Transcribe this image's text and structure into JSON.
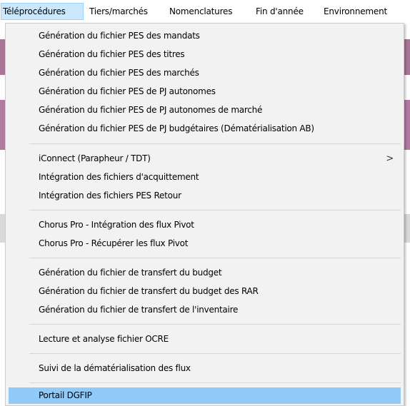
{
  "menubar": {
    "items": [
      {
        "label": "Téléprocédures"
      },
      {
        "label": "Tiers/marchés"
      },
      {
        "label": "Nomenclatures"
      },
      {
        "label": "Fin d'année"
      },
      {
        "label": "Environnement"
      }
    ]
  },
  "dropdown": {
    "groups": [
      {
        "items": [
          {
            "label": "Génération du fichier PES des mandats"
          },
          {
            "label": "Génération du fichier PES des titres"
          },
          {
            "label": "Génération du fichier PES des marchés"
          },
          {
            "label": "Génération du fichier PES de PJ autonomes"
          },
          {
            "label": "Génération du fichier PES de PJ autonomes de marché"
          },
          {
            "label": "Génération du fichier PES de PJ budgétaires (Dématérialisation AB)"
          }
        ]
      },
      {
        "items": [
          {
            "label": "iConnect (Parapheur / TDT)",
            "submenu_glyph": ">"
          },
          {
            "label": "Intégration des fichiers d'acquittement"
          },
          {
            "label": "Intégration des fichiers PES Retour"
          }
        ]
      },
      {
        "items": [
          {
            "label": "Chorus Pro - Intégration des flux Pivot"
          },
          {
            "label": "Chorus Pro - Récupérer les flux Pivot"
          }
        ]
      },
      {
        "items": [
          {
            "label": "Génération du fichier de transfert du budget"
          },
          {
            "label": "Génération du fichier de transfert du budget des RAR"
          },
          {
            "label": "Génération du fichier de transfert de l'inventaire"
          }
        ]
      },
      {
        "items": [
          {
            "label": "Lecture et analyse fichier OCRE"
          }
        ]
      },
      {
        "items": [
          {
            "label": "Suivi de la dématérialisation des flux"
          }
        ]
      },
      {
        "items": [
          {
            "label": "Portail DGFIP",
            "highlighted": true
          }
        ]
      }
    ]
  },
  "colors": {
    "menu_background": "#f2f2f2",
    "highlight": "#91c9f7",
    "active_menubar_item": "#cce8ff",
    "background_app_band": "#b07aa1"
  }
}
